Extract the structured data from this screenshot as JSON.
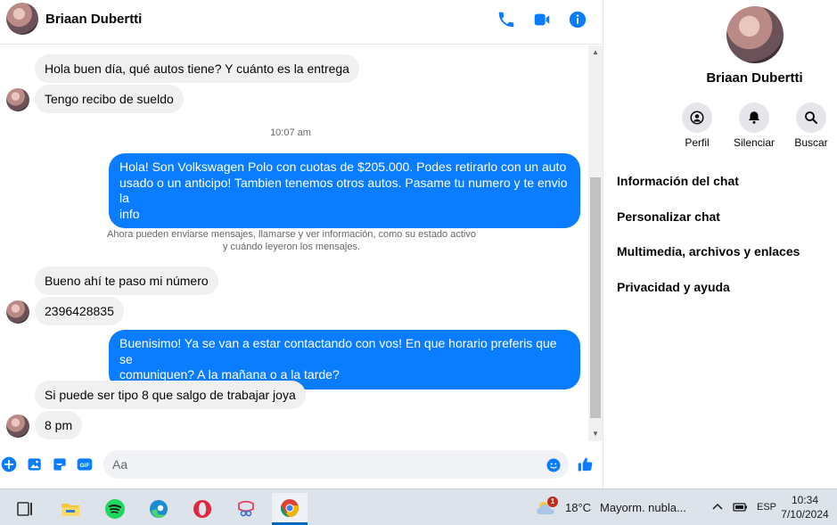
{
  "header": {
    "contact_name": "Briaan Dubertti",
    "icons": [
      "phone-icon",
      "video-icon",
      "info-icon"
    ]
  },
  "messages": [
    {
      "type": "in",
      "text": "Hola buen día, qué autos tiene? Y cuánto es la entrega"
    },
    {
      "type": "in",
      "text": "Tengo recibo de sueldo"
    },
    {
      "type": "timestamp",
      "text": "10:07 am"
    },
    {
      "type": "out",
      "lines": [
        "Hola! Son Volkswagen Polo con cuotas de $205.000. Podes retirarlo con un auto",
        "usado o un anticipo! Tambien tenemos otros autos. Pasame tu numero y te envio la",
        "info"
      ]
    },
    {
      "type": "notice",
      "lines": [
        "Ahora pueden enviarse mensajes, llamarse y ver información, como su estado activo",
        "y cuándo leyeron los mensajes."
      ]
    },
    {
      "type": "in",
      "text": "Bueno ahí te paso mi número"
    },
    {
      "type": "in",
      "text": "2396428835"
    },
    {
      "type": "out",
      "lines": [
        "Buenisimo! Ya se van a estar contactando con vos! En que horario preferis que se",
        "comuniquen? A la mañana o a la tarde?"
      ]
    },
    {
      "type": "in",
      "text": "Si puede ser tipo 8 que salgo de trabajar joya"
    },
    {
      "type": "in",
      "text": "8 pm"
    }
  ],
  "composer": {
    "placeholder": "Aa",
    "icons": [
      "plus-icon",
      "image-icon",
      "sticker-icon",
      "gif-icon",
      "emoji-icon",
      "like-icon"
    ],
    "gif_label": "GIF"
  },
  "info_panel": {
    "name": "Briaan Dubertti",
    "actions": [
      {
        "label": "Perfil",
        "icon": "profile-icon"
      },
      {
        "label": "Silenciar",
        "icon": "bell-icon"
      },
      {
        "label": "Buscar",
        "icon": "search-icon"
      }
    ],
    "menu": [
      "Información del chat",
      "Personalizar chat",
      "Multimedia, archivos y enlaces",
      "Privacidad y ayuda"
    ]
  },
  "taskbar": {
    "apps": [
      "task-view-icon",
      "file-explorer-icon",
      "spotify-icon",
      "edge-icon",
      "opera-icon",
      "snipping-tool-icon",
      "chrome-icon"
    ],
    "weather_temp": "18°C",
    "weather_text": "Mayorm. nubla...",
    "weather_badge": "1",
    "language": "ESP",
    "time": "10:34",
    "date": "7/10/2024"
  },
  "colors": {
    "accent": "#0a7cff",
    "incoming_bubble": "#f0f0f0",
    "taskbar": "#dde3ea"
  }
}
